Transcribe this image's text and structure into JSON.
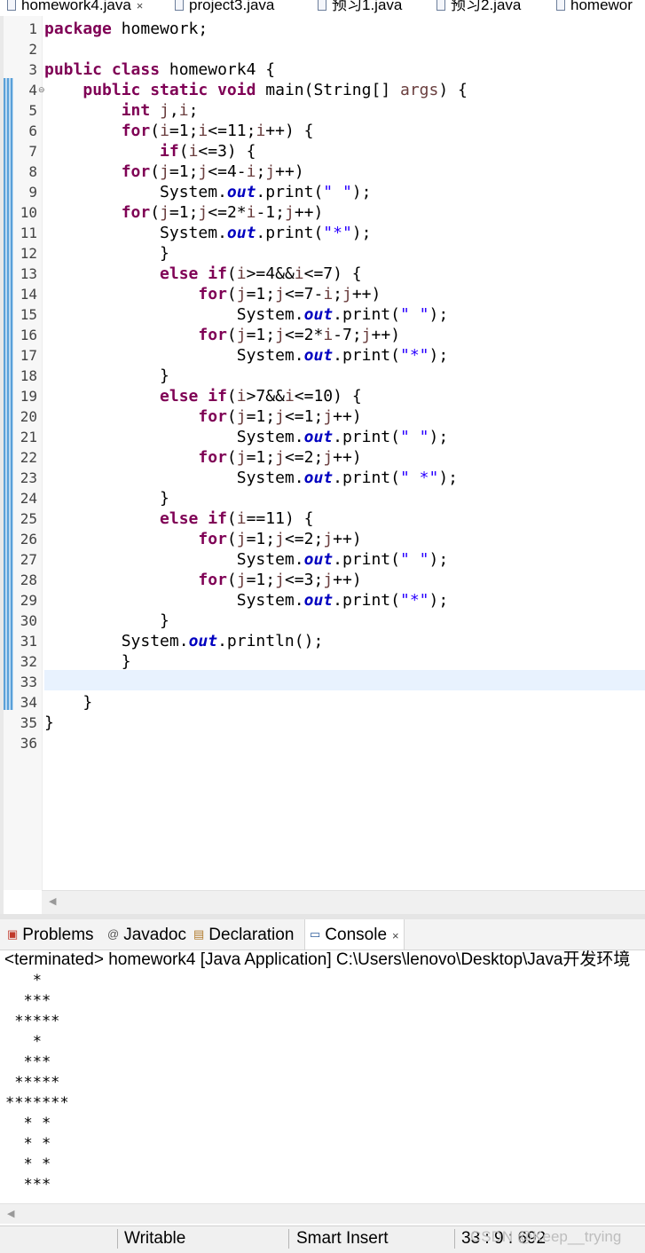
{
  "editor_tabs": [
    {
      "label": "homework4.java",
      "close": "×"
    },
    {
      "label": "project3.java"
    },
    {
      "label": "预习1.java"
    },
    {
      "label": "预习2.java"
    },
    {
      "label": "homewor"
    }
  ],
  "line_numbers": "1\n2\n3\n4\n5\n6\n7\n8\n9\n10\n11\n12\n13\n14\n15\n16\n17\n18\n19\n20\n21\n22\n23\n24\n25\n26\n27\n28\n29\n30\n31\n32\n33\n34\n35\n36",
  "code": {
    "package_kw": "package",
    "package_name": " homework;",
    "l3_kw": "public class",
    "l3_rest": " homework4 {",
    "l4_indent": "    ",
    "l4_kw": "public static void",
    "l4_rest": " main(String[] ",
    "l4_arg": "args",
    "l4_end": ") {",
    "l5_indent": "        ",
    "l5_kw": "int",
    "l5_sp": " ",
    "l5_j": "j",
    "l5_comma": ",",
    "l5_i": "i",
    "l5_end": ";",
    "l6_indent": "        ",
    "l6_kw": "for",
    "l6_a": "(",
    "l6_i1": "i",
    "l6_b": "=1;",
    "l6_i2": "i",
    "l6_c": "<=11;",
    "l6_i3": "i",
    "l6_d": "++) {",
    "l7_indent": "            ",
    "l7_kw": "if",
    "l7_a": "(",
    "l7_i": "i",
    "l7_b": "<=3) {",
    "l8_indent": "        ",
    "l8_kw": "for",
    "l8_a": "(",
    "l8_j1": "j",
    "l8_b": "=1;",
    "l8_j2": "j",
    "l8_c": "<=4-",
    "l8_i": "i",
    "l8_d": ";",
    "l8_j3": "j",
    "l8_e": "++)",
    "l9_indent": "            ",
    "l9_a": "System.",
    "l9_out": "out",
    "l9_b": ".print(",
    "l9_str": "\" \"",
    "l9_c": ");",
    "l10_indent": "        ",
    "l10_kw": "for",
    "l10_a": "(",
    "l10_j1": "j",
    "l10_b": "=1;",
    "l10_j2": "j",
    "l10_c": "<=2*",
    "l10_i": "i",
    "l10_d": "-1;",
    "l10_j3": "j",
    "l10_e": "++)",
    "l11_indent": "            ",
    "l11_a": "System.",
    "l11_out": "out",
    "l11_b": ".print(",
    "l11_str": "\"*\"",
    "l11_c": ");",
    "l12": "            }",
    "l13_indent": "            ",
    "l13_kw": "else if",
    "l13_a": "(",
    "l13_i1": "i",
    "l13_b": ">=4&&",
    "l13_i2": "i",
    "l13_c": "<=7) {",
    "l14_indent": "                ",
    "l14_kw": "for",
    "l14_a": "(",
    "l14_j1": "j",
    "l14_b": "=1;",
    "l14_j2": "j",
    "l14_c": "<=7-",
    "l14_i": "i",
    "l14_d": ";",
    "l14_j3": "j",
    "l14_e": "++)",
    "l15_indent": "                    ",
    "l15_a": "System.",
    "l15_out": "out",
    "l15_b": ".print(",
    "l15_str": "\" \"",
    "l15_c": ");",
    "l16_indent": "                ",
    "l16_kw": "for",
    "l16_a": "(",
    "l16_j1": "j",
    "l16_b": "=1;",
    "l16_j2": "j",
    "l16_c": "<=2*",
    "l16_i": "i",
    "l16_d": "-7;",
    "l16_j3": "j",
    "l16_e": "++)",
    "l17_indent": "                    ",
    "l17_a": "System.",
    "l17_out": "out",
    "l17_b": ".print(",
    "l17_str": "\"*\"",
    "l17_c": ");",
    "l18": "            }",
    "l19_indent": "            ",
    "l19_kw": "else if",
    "l19_a": "(",
    "l19_i1": "i",
    "l19_b": ">7&&",
    "l19_i2": "i",
    "l19_c": "<=10) {",
    "l20_indent": "                ",
    "l20_kw": "for",
    "l20_a": "(",
    "l20_j1": "j",
    "l20_b": "=1;",
    "l20_j2": "j",
    "l20_c": "<=1;",
    "l20_j3": "j",
    "l20_d": "++)",
    "l21_indent": "                    ",
    "l21_a": "System.",
    "l21_out": "out",
    "l21_b": ".print(",
    "l21_str": "\" \"",
    "l21_c": ");",
    "l22_indent": "                ",
    "l22_kw": "for",
    "l22_a": "(",
    "l22_j1": "j",
    "l22_b": "=1;",
    "l22_j2": "j",
    "l22_c": "<=2;",
    "l22_j3": "j",
    "l22_d": "++)",
    "l23_indent": "                    ",
    "l23_a": "System.",
    "l23_out": "out",
    "l23_b": ".print(",
    "l23_str": "\" *\"",
    "l23_c": ");",
    "l24": "            }",
    "l25_indent": "            ",
    "l25_kw": "else if",
    "l25_a": "(",
    "l25_i": "i",
    "l25_b": "==11) {",
    "l26_indent": "                ",
    "l26_kw": "for",
    "l26_a": "(",
    "l26_j1": "j",
    "l26_b": "=1;",
    "l26_j2": "j",
    "l26_c": "<=2;",
    "l26_j3": "j",
    "l26_d": "++)",
    "l27_indent": "                    ",
    "l27_a": "System.",
    "l27_out": "out",
    "l27_b": ".print(",
    "l27_str": "\" \"",
    "l27_c": ");",
    "l28_indent": "                ",
    "l28_kw": "for",
    "l28_a": "(",
    "l28_j1": "j",
    "l28_b": "=1;",
    "l28_j2": "j",
    "l28_c": "<=3;",
    "l28_j3": "j",
    "l28_d": "++)",
    "l29_indent": "                    ",
    "l29_a": "System.",
    "l29_out": "out",
    "l29_b": ".print(",
    "l29_str": "\"*\"",
    "l29_c": ");",
    "l30": "            }",
    "l31_indent": "        ",
    "l31_a": "System.",
    "l31_out": "out",
    "l31_b": ".println();",
    "l32": "        }",
    "l34": "    }",
    "l35": "}"
  },
  "view_tabs": [
    {
      "label": "Problems",
      "icon": "problems-icon"
    },
    {
      "label": "Javadoc",
      "icon": "javadoc-icon"
    },
    {
      "label": "Declaration",
      "icon": "declaration-icon"
    },
    {
      "label": "Console",
      "icon": "console-icon",
      "close": "×"
    }
  ],
  "console": {
    "description": "<terminated> homework4 [Java Application] C:\\Users\\lenovo\\Desktop\\Java开发环境",
    "output": "   *\n  ***\n *****\n   *\n  ***\n *****\n*******\n  * *\n  * *\n  * *\n  ***"
  },
  "status_bar": {
    "writable": "Writable",
    "insert_mode": "Smart Insert",
    "position": "33 : 9 : 692"
  },
  "watermark": "CSDN @Keep__trying",
  "colors": {
    "keyword": "#7f0055",
    "string": "#2a00ff",
    "field": "#0000c0",
    "local_variable": "#6a3e3e",
    "current_line": "#e8f2fe"
  }
}
